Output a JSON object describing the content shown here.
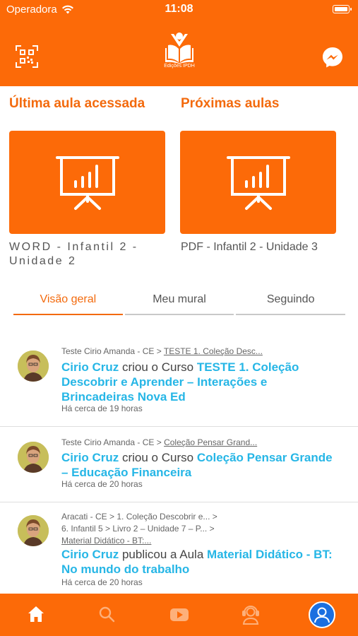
{
  "status_bar": {
    "carrier": "Operadora",
    "time": "11:08"
  },
  "header": {
    "logo_text": "Edições IPDH"
  },
  "last_lesson": {
    "title": "Última aula acessada",
    "label": "WORD - Infantil 2 - Unidade 2"
  },
  "next_lessons": {
    "title": "Próximas aulas",
    "label": "PDF - Infantil 2 - Unidade 3"
  },
  "tabs": [
    {
      "label": "Visão geral",
      "active": true
    },
    {
      "label": "Meu mural",
      "active": false
    },
    {
      "label": "Seguindo",
      "active": false
    }
  ],
  "feed": [
    {
      "crumb_prefix": "Teste Cirio Amanda - CE >",
      "crumb_link": "TESTE 1. Coleção Desc...",
      "author": "Cirio Cruz",
      "action": "criou o Curso",
      "target": "TESTE 1. Coleção Descobrir e Aprender – Interações e Brincadeiras Nova Ed",
      "time": "Há cerca de 19 horas"
    },
    {
      "crumb_prefix": "Teste Cirio Amanda - CE >",
      "crumb_link": "Coleção Pensar Grand...",
      "author": "Cirio Cruz",
      "action": "criou o Curso",
      "target": "Coleção Pensar Grande – Educação Financeira",
      "time": "Há cerca de 20 horas"
    },
    {
      "crumb_line1": "Aracati - CE >  1. Coleção Descobrir e... >",
      "crumb_line2": "6. Infantil 5 >  Livro 2 – Unidade 7 – P... >",
      "crumb_link": "Material Didático - BT:...",
      "author": "Cirio Cruz",
      "action": "publicou a Aula",
      "target": "Material Didático - BT: No mundo do trabalho",
      "time": "Há cerca de 20 horas"
    }
  ],
  "colors": {
    "brand_orange": "#fc6a08",
    "link_blue": "#26b6e6",
    "title_orange": "#f36a0d"
  },
  "icons": {
    "header_left": "qr-code-icon",
    "header_right": "messenger-icon",
    "cards": "presentation-chart-icon",
    "nav": [
      "home-icon",
      "search-icon",
      "youtube-icon",
      "support-agent-icon",
      "profile-icon"
    ]
  }
}
